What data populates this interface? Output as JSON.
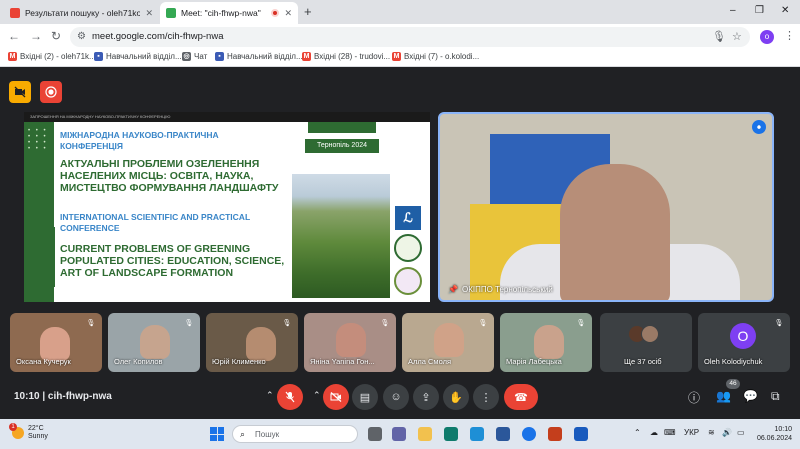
{
  "browser": {
    "tabs": [
      {
        "title": "Результати пошуку - oleh71ko",
        "active": false
      },
      {
        "title": "Meet: \"cih-fhwp-nwa\"",
        "active": true
      }
    ],
    "new_tab": "+",
    "window_controls": [
      "–",
      "❐",
      "✕"
    ],
    "url": "meet.google.com/cih-fhwp-nwa",
    "profile_initial": "o",
    "bookmarks": [
      "Вхідні (2) - oleh71k...",
      "Навчальний відділ...",
      "Чат",
      "Навчальний відділ...",
      "Вхідні (28) - trudovi...",
      "Вхідні (7) - o.kolodi..."
    ]
  },
  "slide": {
    "header_line": "ЗАПРОШЕННЯ НА МІЖНАРОДНУ НАУКОВО-ПРАКТИЧНУ КОНФЕРЕНЦІЮ",
    "ua_conf_type": "МІЖНАРОДНА НАУКОВО-ПРАКТИЧНА КОНФЕРЕНЦІЯ",
    "ua_title": "АКТУАЛЬНІ ПРОБЛЕМИ ОЗЕЛЕНЕННЯ НАСЕЛЕНИХ МІСЦЬ: ОСВІТА, НАУКА, МИСТЕЦТВО ФОРМУВАННЯ ЛАНДШАФТУ",
    "en_conf_type": "INTERNATIONAL SCIENTIFIC AND PRACTICAL CONFERENCE",
    "en_title": "CURRENT PROBLEMS OF GREENING POPULATED CITIES: EDUCATION, SCIENCE, ART OF LANDSCAPE FORMATION",
    "city_year": "Тернопіль 2024"
  },
  "speaker": {
    "name": "ОКІППО Тернопільський"
  },
  "participants": [
    {
      "name": "Оксана Кучерук"
    },
    {
      "name": "Олег Копилов"
    },
    {
      "name": "Юрій Клименко"
    },
    {
      "name": "Яніна Yanina Гон..."
    },
    {
      "name": "Алла Смоля"
    },
    {
      "name": "Марія Лабецька"
    },
    {
      "name": "Ще 37 осіб"
    },
    {
      "name": "Oleh Kolodiychuk",
      "initial": "O"
    }
  ],
  "controls": {
    "time_code": "10:10 | cih-fhwp-nwa",
    "participants_count": "46"
  },
  "taskbar": {
    "temperature": "22°C",
    "condition": "Sunny",
    "weather_badge": "1",
    "search_placeholder": "Пошук",
    "lang": "УКР",
    "time": "10:10",
    "date": "06.06.2024"
  },
  "colors": {
    "meet_bg": "#202124",
    "end_call": "#ea4335",
    "accent": "#1a73e8",
    "slide_green": "#2e6b32",
    "slide_blue": "#3a86c8"
  }
}
